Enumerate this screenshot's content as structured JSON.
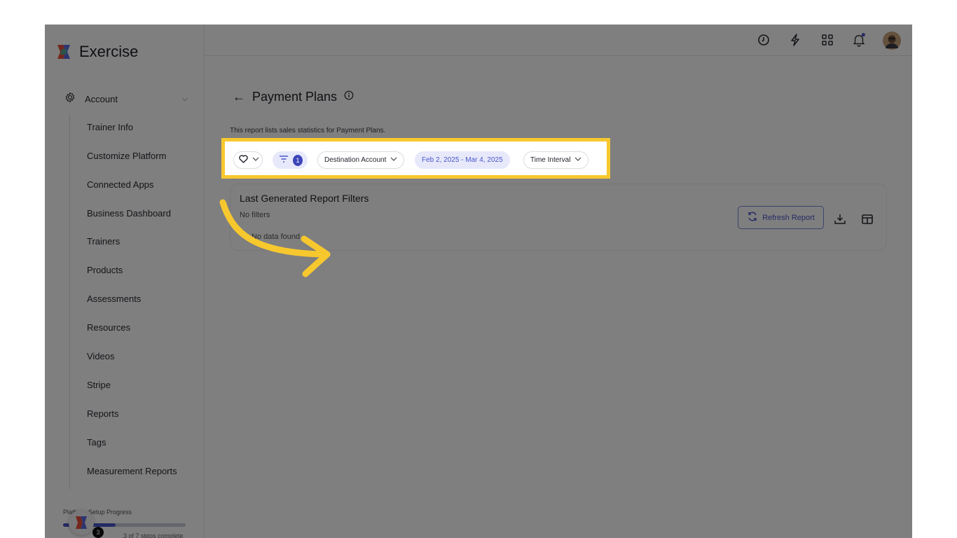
{
  "app": {
    "name": "Exercise"
  },
  "sidebar": {
    "account_label": "Account",
    "items": [
      {
        "label": "Trainer Info"
      },
      {
        "label": "Customize Platform"
      },
      {
        "label": "Connected Apps"
      },
      {
        "label": "Business Dashboard"
      },
      {
        "label": "Trainers"
      },
      {
        "label": "Products"
      },
      {
        "label": "Assessments"
      },
      {
        "label": "Resources"
      },
      {
        "label": "Videos"
      },
      {
        "label": "Stripe"
      },
      {
        "label": "Reports"
      },
      {
        "label": "Tags"
      },
      {
        "label": "Measurement Reports"
      }
    ],
    "setup": {
      "label": "Platform Setup Progress",
      "count": "3",
      "sub": "3 of 7 steps complete",
      "progress": 0.43
    }
  },
  "topbar": {
    "icons": [
      "clock-icon",
      "bolt-icon",
      "apps-grid-icon",
      "bell-icon",
      "user-avatar"
    ]
  },
  "page": {
    "back_symbol": "←",
    "title": "Payment Plans",
    "description": "This report lists sales statistics for Payment Plans."
  },
  "filters": {
    "filter_count": "1",
    "destination_account": "Destination Account",
    "date_range": "Feb 2, 2025 - Mar 4, 2025",
    "time_interval": "Time Interval"
  },
  "card": {
    "title": "Last Generated Report Filters",
    "filters_text": "No filters",
    "empty_text": "No data found",
    "refresh_label": "Refresh Report"
  },
  "colors": {
    "accent": "#4a55c8",
    "highlight": "#f7c82e",
    "overlay": "rgba(0,0,0,0.5)"
  }
}
